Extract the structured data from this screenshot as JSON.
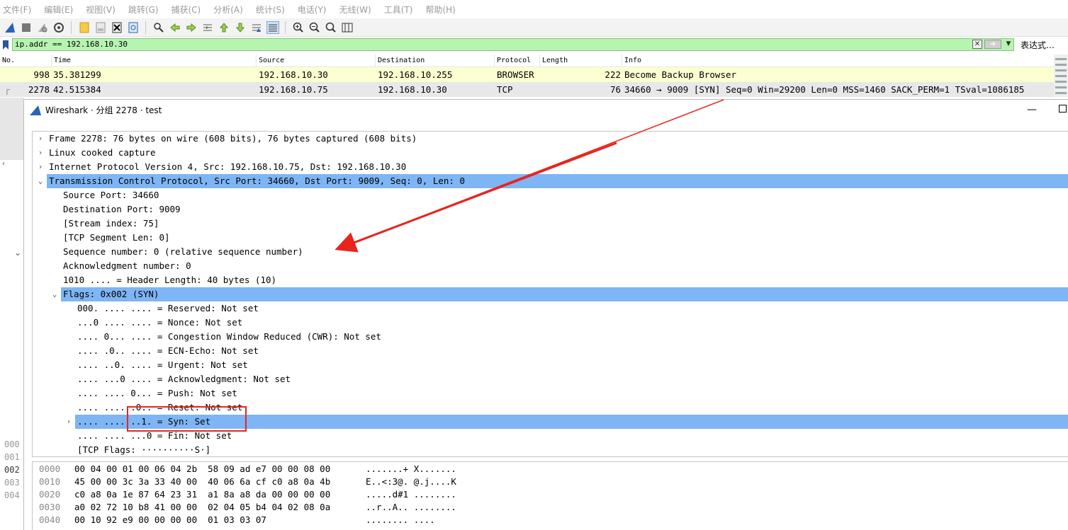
{
  "menu": [
    "文件(F)",
    "编辑(E)",
    "视图(V)",
    "跳转(G)",
    "捕获(C)",
    "分析(A)",
    "统计(S)",
    "电话(Y)",
    "无线(W)",
    "工具(T)",
    "帮助(H)"
  ],
  "toolbar": {
    "icons": [
      "shark-fin-icon",
      "stop-icon",
      "restart-icon",
      "options-icon",
      "open-file-icon",
      "save-icon",
      "close-file-icon",
      "reload-icon",
      "find-icon",
      "back-icon",
      "forward-icon",
      "goto-icon",
      "first-packet-icon",
      "last-packet-icon",
      "autoscroll-icon",
      "colorize-icon",
      "zoom-in-icon",
      "zoom-out-icon",
      "zoom-normal-icon",
      "resize-columns-icon"
    ]
  },
  "filter": {
    "value": "ip.addr == 192.168.10.30",
    "expression_label": "表达式…"
  },
  "packet_list": {
    "columns": [
      "No.",
      "Time",
      "Source",
      "Destination",
      "Protocol",
      "Length",
      "Info"
    ],
    "rows": [
      {
        "no": "998",
        "time": "35.381299",
        "source": "192.168.10.30",
        "destination": "192.168.10.255",
        "protocol": "BROWSER",
        "length": "222",
        "info": "Become Backup Browser"
      },
      {
        "no": "2278",
        "time": "42.515384",
        "source": "192.168.10.75",
        "destination": "192.168.10.30",
        "protocol": "TCP",
        "length": "76",
        "info": "34660 → 9009 [SYN] Seq=0 Win=29200 Len=0 MSS=1460 SACK_PERM=1 TSval=1086185"
      }
    ]
  },
  "background_hex_offsets": [
    "000",
    "001",
    "002",
    "003",
    "004"
  ],
  "dialog": {
    "title": "Wireshark · 分组 2278 · test",
    "minimize_glyph": "—",
    "tree": [
      {
        "arrow": "›",
        "text": "Frame 2278: 76 bytes on wire (608 bits), 76 bytes captured (608 bits)"
      },
      {
        "arrow": "›",
        "text": "Linux cooked capture"
      },
      {
        "arrow": "›",
        "text": "Internet Protocol Version 4, Src: 192.168.10.75, Dst: 192.168.10.30"
      },
      {
        "arrow": "⌄",
        "text": "Transmission Control Protocol, Src Port: 34660, Dst Port: 9009, Seq: 0, Len: 0"
      },
      {
        "arrow": "",
        "text": "Source Port: 34660"
      },
      {
        "arrow": "",
        "text": "Destination Port: 9009"
      },
      {
        "arrow": "",
        "text": "[Stream index: 75]"
      },
      {
        "arrow": "",
        "text": "[TCP Segment Len: 0]"
      },
      {
        "arrow": "",
        "text": "Sequence number: 0    (relative sequence number)"
      },
      {
        "arrow": "",
        "text": "Acknowledgment number: 0"
      },
      {
        "arrow": "",
        "text": "1010 .... = Header Length: 40 bytes (10)"
      },
      {
        "arrow": "⌄",
        "text": "Flags: 0x002 (SYN)"
      },
      {
        "arrow": "",
        "text": "000. .... .... = Reserved: Not set"
      },
      {
        "arrow": "",
        "text": "...0 .... .... = Nonce: Not set"
      },
      {
        "arrow": "",
        "text": ".... 0... .... = Congestion Window Reduced (CWR): Not set"
      },
      {
        "arrow": "",
        "text": ".... .0.. .... = ECN-Echo: Not set"
      },
      {
        "arrow": "",
        "text": ".... ..0. .... = Urgent: Not set"
      },
      {
        "arrow": "",
        "text": ".... ...0 .... = Acknowledgment: Not set"
      },
      {
        "arrow": "",
        "text": ".... .... 0... = Push: Not set"
      },
      {
        "arrow": "",
        "text": ".... .... .0.. = Reset: Not set"
      },
      {
        "arrow": "›",
        "text": ".... .... ..1. = Syn: Set"
      },
      {
        "arrow": "",
        "text": ".... .... ...0 = Fin: Not set"
      },
      {
        "arrow": "",
        "text": "[TCP Flags: ··········S·]"
      }
    ],
    "hex": [
      {
        "offset": "0000",
        "bytes": "00 04 00 01 00 06 04 2b  58 09 ad e7 00 00 08 00",
        "ascii": ".......+ X......."
      },
      {
        "offset": "0010",
        "bytes": "45 00 00 3c 3a 33 40 00  40 06 6a cf c0 a8 0a 4b",
        "ascii": "E..<:3@. @.j....K"
      },
      {
        "offset": "0020",
        "bytes": "c0 a8 0a 1e 87 64 23 31  a1 8a a8 da 00 00 00 00",
        "ascii": ".....d#1 ........"
      },
      {
        "offset": "0030",
        "bytes": "a0 02 72 10 b8 41 00 00  02 04 05 b4 04 02 08 0a",
        "ascii": "..r..A.. ........"
      },
      {
        "offset": "0040",
        "bytes": "00 10 92 e9 00 00 00 00  01 03 03 07",
        "ascii": "........ ...."
      }
    ]
  },
  "colors": {
    "selected_row": "#7eb5f4",
    "filter_bg": "#b6f5b0",
    "browser_row": "#feffd1",
    "annotation": "#e8241c"
  }
}
